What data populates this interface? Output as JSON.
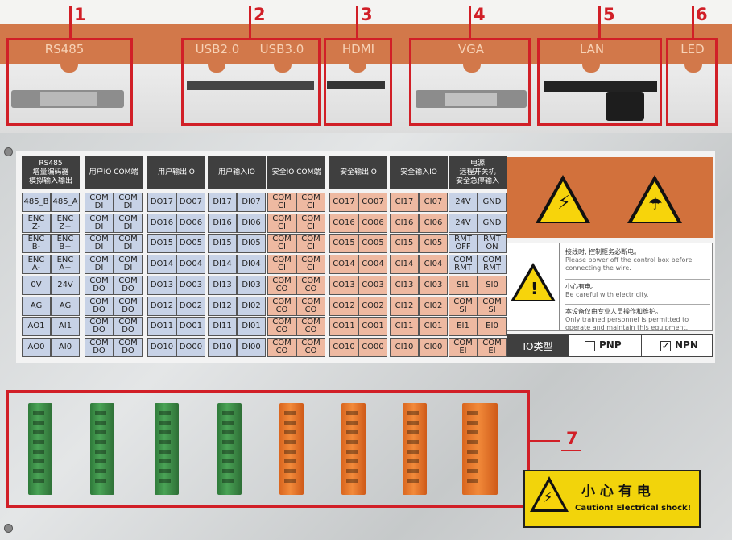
{
  "top_ports": [
    {
      "label": "RS485"
    },
    {
      "label": "USB2.0"
    },
    {
      "label": "USB3.0"
    },
    {
      "label": "HDMI"
    },
    {
      "label": "VGA"
    },
    {
      "label": "LAN"
    },
    {
      "label": "LED"
    }
  ],
  "callouts": [
    "1",
    "2",
    "3",
    "4",
    "5",
    "6",
    "7"
  ],
  "sticker": {
    "columns": [
      {
        "header": "RS485\n增量编码器\n模拟输入输出",
        "color": "blue",
        "rows": [
          [
            "485_B",
            "485_A"
          ],
          [
            "ENC\nZ-",
            "ENC\nZ+"
          ],
          [
            "ENC\nB-",
            "ENC\nB+"
          ],
          [
            "ENC\nA-",
            "ENC\nA+"
          ],
          [
            "0V",
            "24V"
          ],
          [
            "AG",
            "AG"
          ],
          [
            "AO1",
            "AI1"
          ],
          [
            "AO0",
            "AI0"
          ]
        ]
      },
      {
        "header": "用户IO COM端",
        "color": "blue",
        "rows": [
          [
            "COM\nDI",
            "COM\nDI"
          ],
          [
            "COM\nDI",
            "COM\nDI"
          ],
          [
            "COM\nDI",
            "COM\nDI"
          ],
          [
            "COM\nDI",
            "COM\nDI"
          ],
          [
            "COM\nDO",
            "COM\nDO"
          ],
          [
            "COM\nDO",
            "COM\nDO"
          ],
          [
            "COM\nDO",
            "COM\nDO"
          ],
          [
            "COM\nDO",
            "COM\nDO"
          ]
        ]
      },
      {
        "header": "用户输出IO",
        "color": "blue",
        "rows": [
          [
            "DO17",
            "DO07"
          ],
          [
            "DO16",
            "DO06"
          ],
          [
            "DO15",
            "DO05"
          ],
          [
            "DO14",
            "DO04"
          ],
          [
            "DO13",
            "DO03"
          ],
          [
            "DO12",
            "DO02"
          ],
          [
            "DO11",
            "DO01"
          ],
          [
            "DO10",
            "DO00"
          ]
        ]
      },
      {
        "header": "用户输入IO",
        "color": "blue",
        "rows": [
          [
            "DI17",
            "DI07"
          ],
          [
            "DI16",
            "DI06"
          ],
          [
            "DI15",
            "DI05"
          ],
          [
            "DI14",
            "DI04"
          ],
          [
            "DI13",
            "DI03"
          ],
          [
            "DI12",
            "DI02"
          ],
          [
            "DI11",
            "DI01"
          ],
          [
            "DI10",
            "DI00"
          ]
        ]
      },
      {
        "header": "安全IO COM端",
        "color": "salmon",
        "rows": [
          [
            "COM\nCI",
            "COM\nCI"
          ],
          [
            "COM\nCI",
            "COM\nCI"
          ],
          [
            "COM\nCI",
            "COM\nCI"
          ],
          [
            "COM\nCI",
            "COM\nCI"
          ],
          [
            "COM\nCO",
            "COM\nCO"
          ],
          [
            "COM\nCO",
            "COM\nCO"
          ],
          [
            "COM\nCO",
            "COM\nCO"
          ],
          [
            "COM\nCO",
            "COM\nCO"
          ]
        ]
      },
      {
        "header": "安全输出IO",
        "color": "salmon",
        "rows": [
          [
            "CO17",
            "CO07"
          ],
          [
            "CO16",
            "CO06"
          ],
          [
            "CO15",
            "CO05"
          ],
          [
            "CO14",
            "CO04"
          ],
          [
            "CO13",
            "CO03"
          ],
          [
            "CO12",
            "CO02"
          ],
          [
            "CO11",
            "CO01"
          ],
          [
            "CO10",
            "CO00"
          ]
        ]
      },
      {
        "header": "安全输入IO",
        "color": "salmon",
        "rows": [
          [
            "CI17",
            "CI07"
          ],
          [
            "CI16",
            "CI06"
          ],
          [
            "CI15",
            "CI05"
          ],
          [
            "CI14",
            "CI04"
          ],
          [
            "CI13",
            "CI03"
          ],
          [
            "CI12",
            "CI02"
          ],
          [
            "CI11",
            "CI01"
          ],
          [
            "CI10",
            "CI00"
          ]
        ]
      },
      {
        "header": "电源\n远程开关机\n安全急停输入",
        "color": "mixed",
        "rows": [
          [
            "24V",
            "GND"
          ],
          [
            "24V",
            "GND"
          ],
          [
            "RMT\nOFF",
            "RMT\nON"
          ],
          [
            "COM\nRMT",
            "COM\nRMT"
          ],
          [
            "SI1",
            "SI0"
          ],
          [
            "COM\nSI",
            "COM\nSI"
          ],
          [
            "EI1",
            "EI0"
          ],
          [
            "COM\nEI",
            "COM\nEI"
          ]
        ]
      }
    ],
    "notice": {
      "line1_cn": "接线时, 控制柜务必断电。",
      "line1_en": "Please power off the control box before connecting the wire.",
      "line2_cn": "小心有电。",
      "line2_en": "Be careful with electricity.",
      "line3_cn": "本设备仅由专业人员操作和维护。",
      "line3_en": "Only trained personnel is permitted to operate and maintain this equipment."
    },
    "io_type": {
      "label": "IO类型",
      "pnp": "PNP",
      "npn": "NPN",
      "checked": "NPN"
    }
  },
  "caution": {
    "cn": "小 心 有 电",
    "en": "Caution! Electrical shock!"
  },
  "colors": {
    "callout": "#d11f27",
    "orange_band": "#d2784a",
    "blue_cell": "#c7d2e6",
    "salmon_cell": "#eeb9a1",
    "connector_green": "#3f9150",
    "connector_orange": "#ee7f32"
  }
}
